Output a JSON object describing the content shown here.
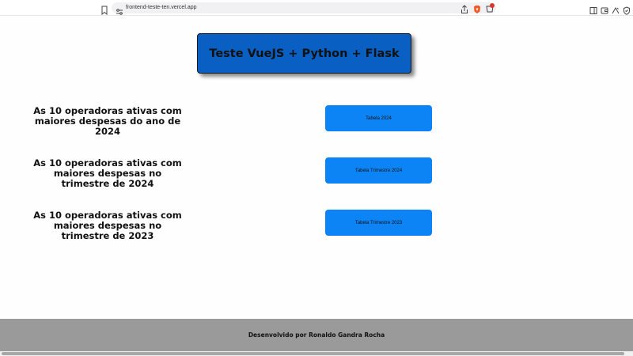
{
  "browser": {
    "url": "frontend-teste-ten.vercel.app",
    "icons": [
      "bookmark-icon",
      "site-info-icon",
      "share-icon",
      "brave-shield-icon",
      "brave-rewards-icon",
      "sidebar-icon",
      "wallet-icon",
      "leo-icon",
      "vpn-icon"
    ],
    "rewards_badge": "1"
  },
  "header": {
    "title": "Teste VueJS + Python + Flask"
  },
  "rows": [
    {
      "description": "As 10 operadoras ativas com maiores despesas do ano de 2024",
      "button_label": "Tabela 2024"
    },
    {
      "description": "As 10 operadoras ativas com maiores despesas no trimestre de 2024",
      "button_label": "Tabela Trimestre 2024"
    },
    {
      "description": "As 10 operadoras ativas com maiores despesas no trimestre de 2023",
      "button_label": "Tabela Trimestre 2023"
    }
  ],
  "footer": {
    "text": "Desenvolvido por Ronaldo Gandra Rocha"
  },
  "colors": {
    "title_bg": "#0a5fc2",
    "button_bg": "#0d84f5",
    "footer_bg": "#9a9a9a"
  }
}
